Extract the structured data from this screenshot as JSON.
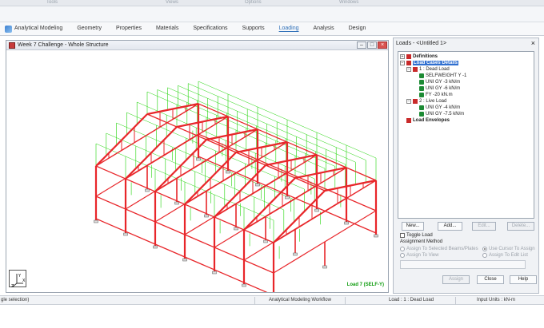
{
  "top_strip": {
    "items": [
      "Tools",
      "Views",
      "Options",
      "Windows"
    ]
  },
  "ribbon": {
    "tabs": [
      "Analytical Modeling",
      "Geometry",
      "Properties",
      "Materials",
      "Specifications",
      "Supports",
      "Loading",
      "Analysis",
      "Design"
    ],
    "active_tab": "Loading"
  },
  "document_window": {
    "title": "Week 7 Challenge - Whole Structure",
    "minimize": "–",
    "maximize": "□",
    "close": "×",
    "load_label": "Load 7 (SELF-Y)",
    "axis_labels": {
      "y": "Y",
      "x": "X",
      "z": "Z"
    }
  },
  "loads_panel": {
    "title": "Loads - <Untitled 1>",
    "close": "×",
    "tree": {
      "definitions": "Definitions",
      "load_cases_details": "Load Cases Details",
      "case1": "1 : Dead Load",
      "case1_items": [
        "SELFWEIGHT Y -1",
        "UNI GY -3 kN/m",
        "UNI GY -6 kN/m",
        "FY -20 kN.m"
      ],
      "case2": "2 : Live Load",
      "case2_items": [
        "UNI GY -4 kN/m",
        "UNI GY -7.5 kN/m"
      ],
      "load_envelopes": "Load Envelopes"
    },
    "buttons": {
      "new": "New...",
      "add": "Add...",
      "edit": "Edit...",
      "delete": "Delete..."
    },
    "toggle_load": "Toggle Load",
    "assignment_method": "Assignment Method",
    "options": {
      "assign_selected": "Assign To Selected Beams/Plates",
      "use_cursor": "Use Cursor To Assign",
      "assign_view": "Assign To View",
      "assign_edit_list": "Assign To Edit List"
    },
    "footer_buttons": {
      "assign": "Assign",
      "close": "Close",
      "help": "Help"
    }
  },
  "status_bar": {
    "left": "gle selection)",
    "workflow": "Analytical Modeling Workflow",
    "load": "Load : 1 : Dead Load",
    "units": "Input Units : kN-m"
  },
  "colors": {
    "members": "#e8262a",
    "loads": "#22d40a",
    "accent": "#2f6fd0"
  }
}
